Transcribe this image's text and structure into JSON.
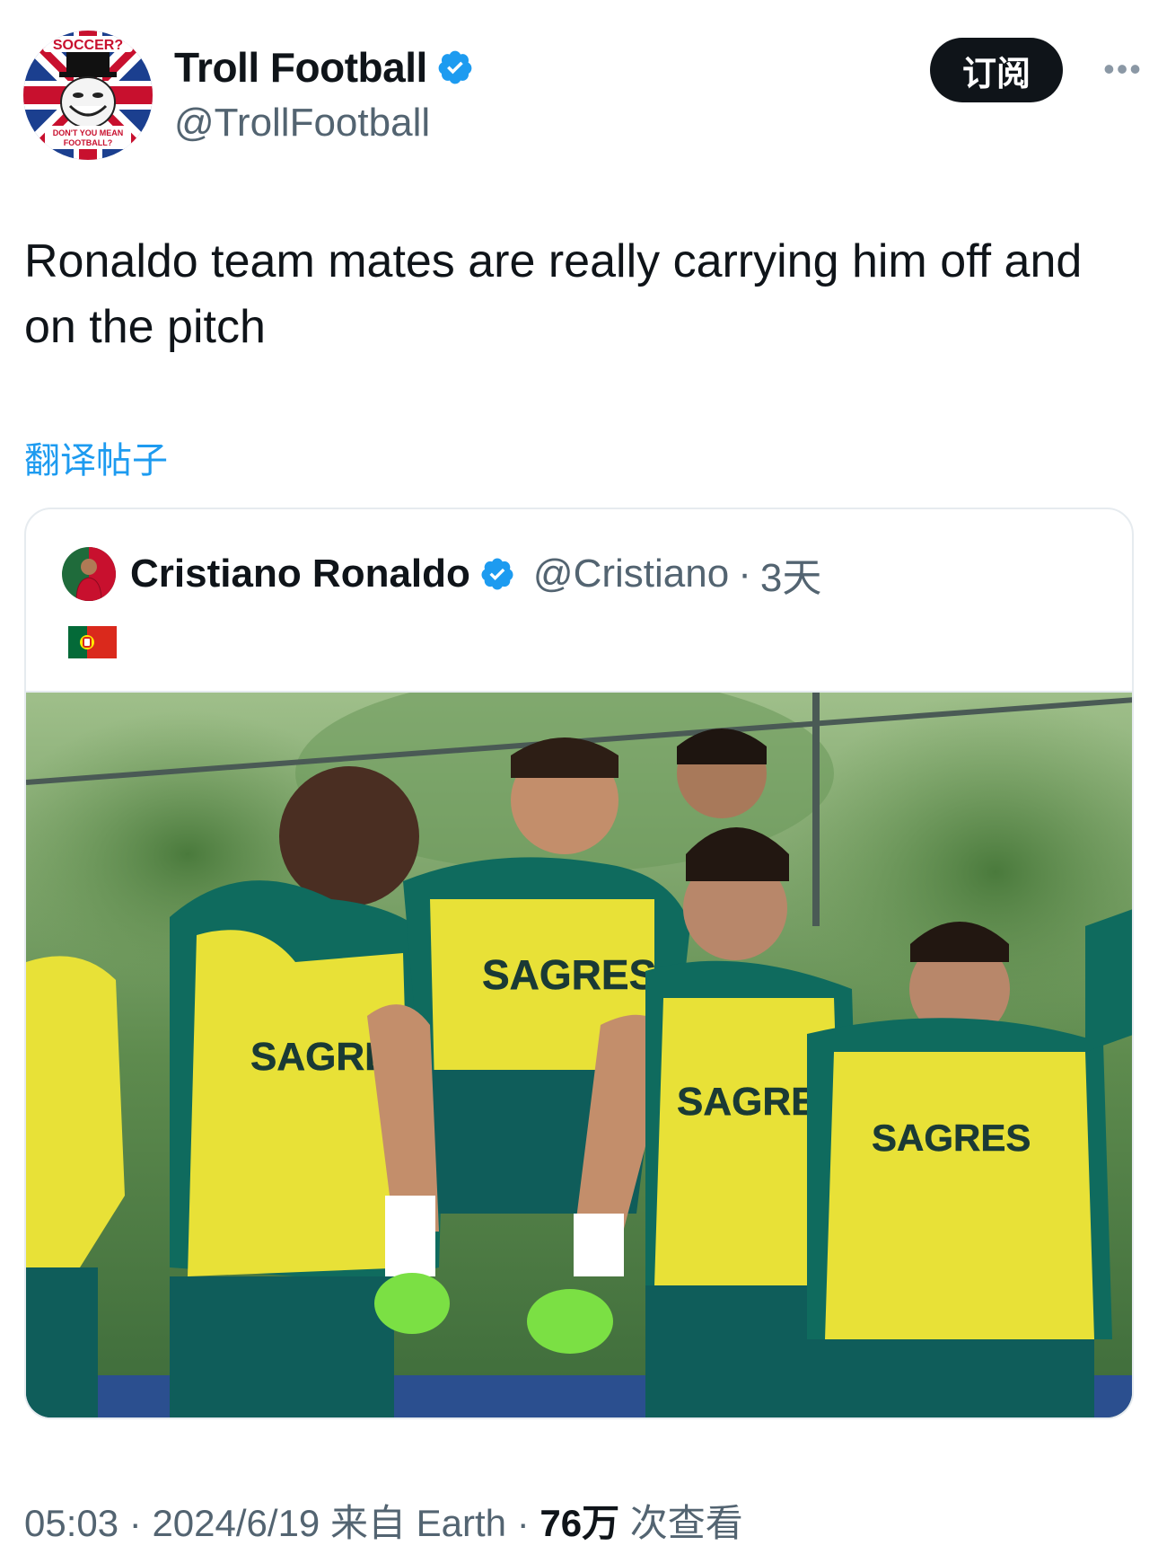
{
  "header": {
    "display_name": "Troll Football",
    "handle": "@TrollFootball",
    "subscribe_label": "订阅",
    "more_label": "•••",
    "avatar_text_top": "SOCCER?",
    "avatar_text_bottom_1": "DON'T YOU MEAN",
    "avatar_text_bottom_2": "FOOTBALL?"
  },
  "tweet": {
    "text": "Ronaldo team mates are really carrying him off and on the pitch",
    "translate_label": "翻译帖子"
  },
  "quoted": {
    "display_name": "Cristiano Ronaldo",
    "handle": "@Cristiano",
    "separator": "·",
    "time": "3天",
    "flag_icon": "portugal-flag-icon",
    "bib_text": "SAGRES"
  },
  "footer": {
    "time": "05:03",
    "sep1": " · ",
    "date": "2024/6/19",
    "source": " 来自 Earth",
    "sep2": " · ",
    "views_count": "76万",
    "views_label": " 次查看"
  },
  "colors": {
    "verified": "#1d9bf0",
    "link": "#1d9bf0",
    "secondary_text": "#536471",
    "primary_text": "#0f1419",
    "border": "#e6ebef"
  }
}
